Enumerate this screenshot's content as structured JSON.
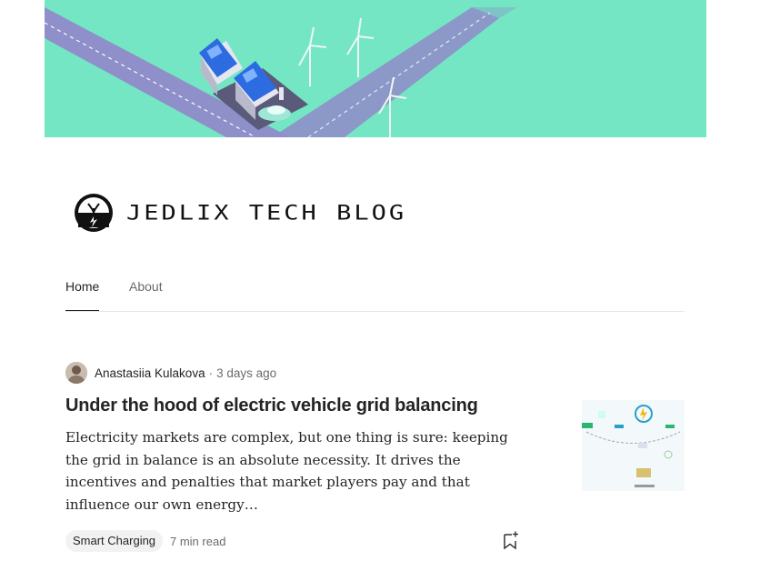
{
  "publication": {
    "name": "JEDLIX TECH BLOG",
    "logo_icon": "jedlix-plug-logo-icon",
    "hero_image": "ev-smart-grid-illustration"
  },
  "nav": {
    "tabs": [
      {
        "label": "Home",
        "active": true
      },
      {
        "label": "About",
        "active": false
      }
    ]
  },
  "article": {
    "author": "Anastasiia Kulakova",
    "separator": "·",
    "date": "3 days ago",
    "title": "Under the hood of electric vehicle grid balancing",
    "excerpt": "Electricity markets are complex, but one thing is sure: keeping the grid in balance is an absolute necessity. It drives the incentives and penalties that market players pay and that influence our own energy…",
    "tag": "Smart Charging",
    "read_time": "7 min read",
    "bookmark_icon": "bookmark-add-icon"
  },
  "colors": {
    "hero_bg": "#74e6c4",
    "road": "#8f8fc9",
    "text": "#242424",
    "muted": "#6b6b6b",
    "tag_bg": "#f2f2f2"
  }
}
